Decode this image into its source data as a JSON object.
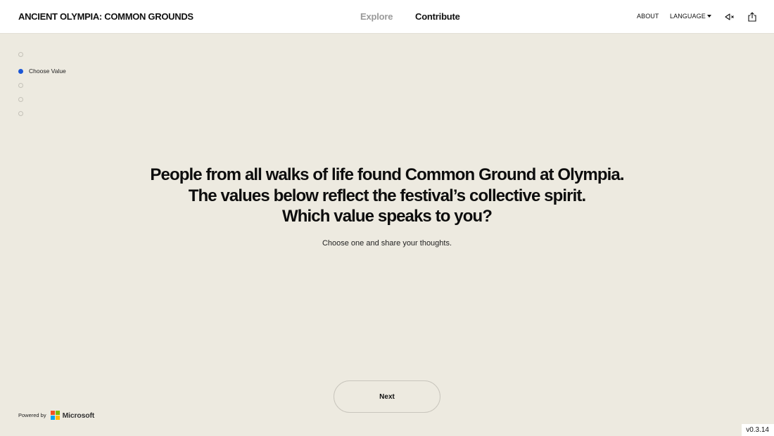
{
  "header": {
    "site_title": "ANCIENT OLYMPIA: COMMON GROUNDS",
    "nav": {
      "explore": "Explore",
      "contribute": "Contribute"
    },
    "about": "ABOUT",
    "language": "LANGUAGE",
    "icons": [
      "speaker-mute-icon",
      "share-icon"
    ]
  },
  "progress": {
    "steps": [
      {
        "label": "",
        "active": false
      },
      {
        "label": "Choose Value",
        "active": true
      },
      {
        "label": "",
        "active": false
      },
      {
        "label": "",
        "active": false
      },
      {
        "label": "",
        "active": false
      }
    ]
  },
  "hero": {
    "line1": "People from all walks of life found Common Ground at Olympia.",
    "line2": "The values below reflect the festival’s collective spirit.",
    "line3": "Which value speaks to you?",
    "subtitle": "Choose one and share your thoughts."
  },
  "actions": {
    "next_label": "Next"
  },
  "footer": {
    "powered_by": "Powered by",
    "brand": "Microsoft",
    "version": "v0.3.14"
  },
  "colors": {
    "background": "#edeae0",
    "header_background": "#ffffff",
    "accent": "#1b56d6",
    "ms_red": "#f25022",
    "ms_green": "#7fba00",
    "ms_blue": "#00a4ef",
    "ms_yellow": "#ffb900"
  }
}
